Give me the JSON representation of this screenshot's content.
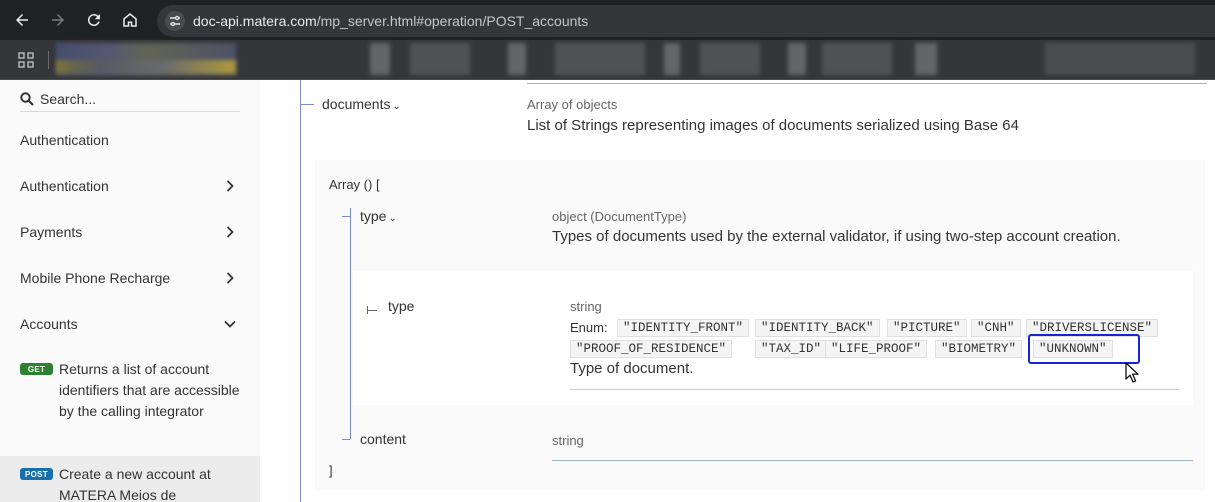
{
  "browser": {
    "url_host": "doc-api.matera.com",
    "url_path": "/mp_server.html#operation/POST_accounts"
  },
  "sidebar": {
    "search_placeholder": "Search...",
    "items": [
      {
        "label": "Authentication"
      },
      {
        "label": "Authentication"
      },
      {
        "label": "Payments"
      },
      {
        "label": "Mobile Phone Recharge"
      },
      {
        "label": "Accounts"
      }
    ],
    "operations": [
      {
        "method": "GET",
        "label": "Returns a list of account identifiers that are accessible by the calling integrator"
      },
      {
        "method": "POST",
        "label": "Create a new account at MATERA Meios de"
      }
    ]
  },
  "schema": {
    "documents": {
      "name": "documents",
      "type": "Array of objects",
      "description": "List of Strings representing images of documents serialized using Base 64"
    },
    "array_open": "Array () [",
    "array_close": "]",
    "type_object": {
      "name": "type",
      "type": "object (DocumentType)",
      "description": "Types of documents used by the external validator, if using two-step account creation."
    },
    "type_string": {
      "name": "type",
      "type": "string",
      "enum_label": "Enum:",
      "enum_values": [
        "\"IDENTITY_FRONT\"",
        "\"IDENTITY_BACK\"",
        "\"PICTURE\"",
        "\"CNH\"",
        "\"DRIVERSLICENSE\"",
        "\"PROOF_OF_RESIDENCE\"",
        "\"TAX_ID\"",
        "\"LIFE_PROOF\"",
        "\"BIOMETRY\"",
        "\"UNKNOWN\""
      ],
      "description": "Type of document."
    },
    "content": {
      "name": "content",
      "type": "string"
    }
  },
  "colors": {
    "highlight": "#1a22d6",
    "get_badge": "#2f8132",
    "post_badge": "#186fae"
  }
}
